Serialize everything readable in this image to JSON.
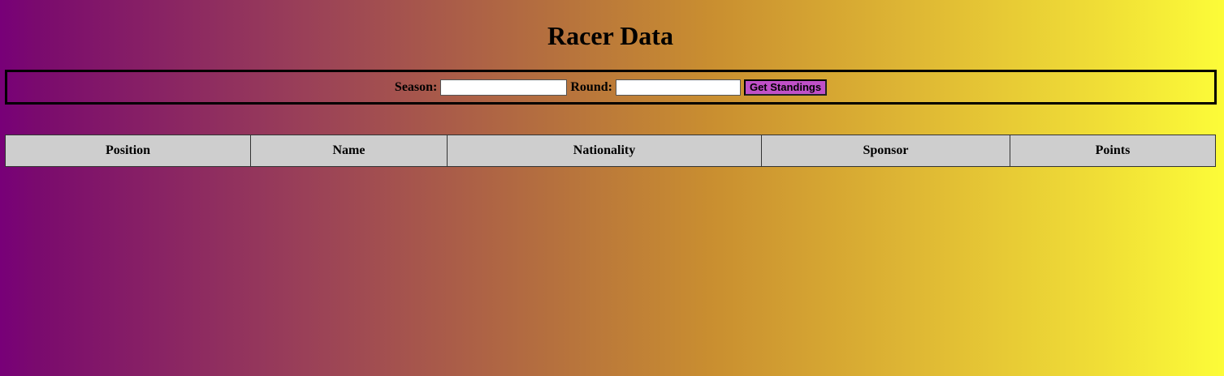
{
  "page": {
    "title": "Racer Data"
  },
  "form": {
    "season_label": "Season:",
    "season_value": "",
    "round_label": "Round:",
    "round_value": "",
    "submit_label": "Get Standings"
  },
  "table": {
    "columns": [
      "Position",
      "Name",
      "Nationality",
      "Sponsor",
      "Points"
    ]
  },
  "colors": {
    "gradient_left": "#780078",
    "gradient_right": "#fcfc38",
    "button_bg": "#c050c8",
    "table_header_bg": "#cecece"
  }
}
